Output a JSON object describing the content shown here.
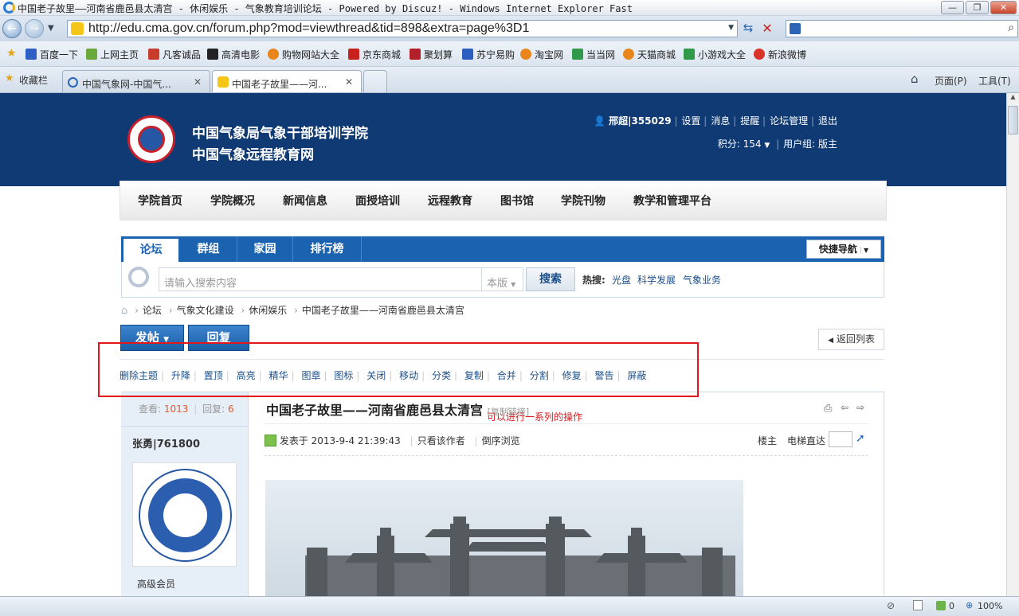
{
  "browser": {
    "window_title": "中国老子故里——河南省鹿邑县太清宫 - 休闲娱乐 - 气象教育培训论坛 - Powered by Discuz! - Windows Internet Explorer Fast",
    "url": "http://edu.cma.gov.cn/forum.php?mod=viewthread&tid=898&extra=page%3D1",
    "favorites": [
      "百度一下",
      "上网主页",
      "凡客诚品",
      "高清电影",
      "购物网站大全",
      "京东商城",
      "聚划算",
      "苏宁易购",
      "淘宝网",
      "当当网",
      "天猫商城",
      "小游戏大全",
      "新浪微博"
    ],
    "favorites_bar_label": "收藏栏",
    "tabs": [
      {
        "label": "中国气象网-中国气..."
      },
      {
        "label": "中国老子故里——河..."
      }
    ],
    "toolbar": {
      "page": "页面(P)",
      "tools": "工具(T)"
    },
    "status": {
      "zoom": "100%",
      "counter": "0"
    }
  },
  "site": {
    "name_line1": "中国气象局气象干部培训学院",
    "name_line2": "中国气象远程教育网",
    "user": {
      "name": "邢超|355029",
      "links": [
        "设置",
        "消息",
        "提醒",
        "论坛管理",
        "退出"
      ],
      "points": "积分: 154",
      "group": "用户组: 版主"
    },
    "nav": [
      "学院首页",
      "学院概况",
      "新闻信息",
      "面授培训",
      "远程教育",
      "图书馆",
      "学院刊物",
      "教学和管理平台"
    ]
  },
  "forum": {
    "tabs": [
      "论坛",
      "群组",
      "家园",
      "排行榜"
    ],
    "quick_nav": "快捷导航",
    "search": {
      "placeholder": "请输入搜索内容",
      "scope": "本版",
      "button": "搜索",
      "hot_label": "热搜:",
      "hot": [
        "光盘",
        "科学发展",
        "气象业务"
      ]
    },
    "breadcrumb": [
      "论坛",
      "气象文化建设",
      "休闲娱乐",
      "中国老子故里——河南省鹿邑县太清宫"
    ],
    "annotation": "可以进行一系列的操作",
    "buttons": {
      "post": "发帖",
      "reply": "回复",
      "back": "返回列表"
    },
    "mod_actions": [
      "删除主题",
      "升降",
      "置顶",
      "高亮",
      "精华",
      "图章",
      "图标",
      "关闭",
      "移动",
      "分类",
      "复制",
      "合并",
      "分割",
      "修复",
      "警告",
      "屏蔽"
    ],
    "thread": {
      "views_label": "查看:",
      "views": "1013",
      "replies_label": "回复:",
      "replies": "6",
      "title": "中国老子故里——河南省鹿邑县太清宫",
      "copy_link": "[复制链接]",
      "author": "张勇|761800",
      "author_rank": "高级会员",
      "posted": "发表于 2013-9-4 21:39:43",
      "only_author": "只看该作者",
      "reverse": "倒序浏览",
      "floor": "楼主",
      "jump_label": "电梯直达"
    }
  }
}
